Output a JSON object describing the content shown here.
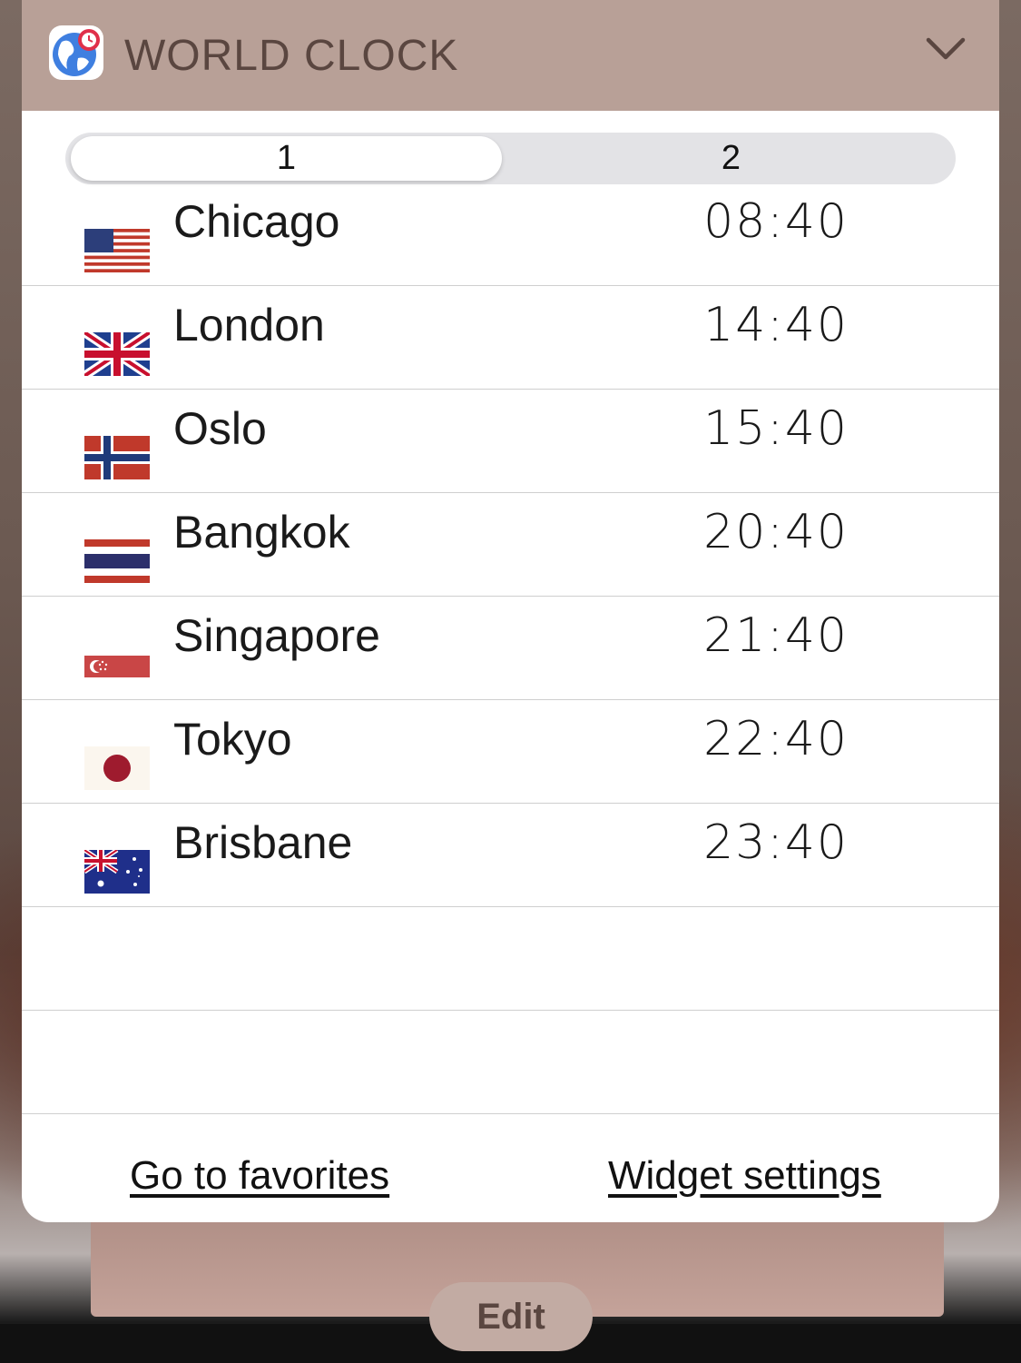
{
  "widget": {
    "title": "WORLD CLOCK",
    "icon": "globe-clock-icon",
    "collapse_icon": "chevron-down-icon"
  },
  "tabs": [
    {
      "label": "1",
      "selected": true
    },
    {
      "label": "2",
      "selected": false
    }
  ],
  "clocks": [
    {
      "city": "Chicago",
      "time": "08:40",
      "flag": "usa-flag-icon"
    },
    {
      "city": "London",
      "time": "14:40",
      "flag": "uk-flag-icon"
    },
    {
      "city": "Oslo",
      "time": "15:40",
      "flag": "norway-flag-icon"
    },
    {
      "city": "Bangkok",
      "time": "20:40",
      "flag": "thailand-flag-icon"
    },
    {
      "city": "Singapore",
      "time": "21:40",
      "flag": "singapore-flag-icon"
    },
    {
      "city": "Tokyo",
      "time": "22:40",
      "flag": "japan-flag-icon"
    },
    {
      "city": "Brisbane",
      "time": "23:40",
      "flag": "australia-flag-icon"
    }
  ],
  "footer": {
    "favorites_label": "Go to favorites",
    "settings_label": "Widget settings"
  },
  "edit_label": "Edit",
  "colors": {
    "header_bg": "#b8a097",
    "header_text": "#5a4640",
    "edit_bg": "#c2aba3"
  }
}
